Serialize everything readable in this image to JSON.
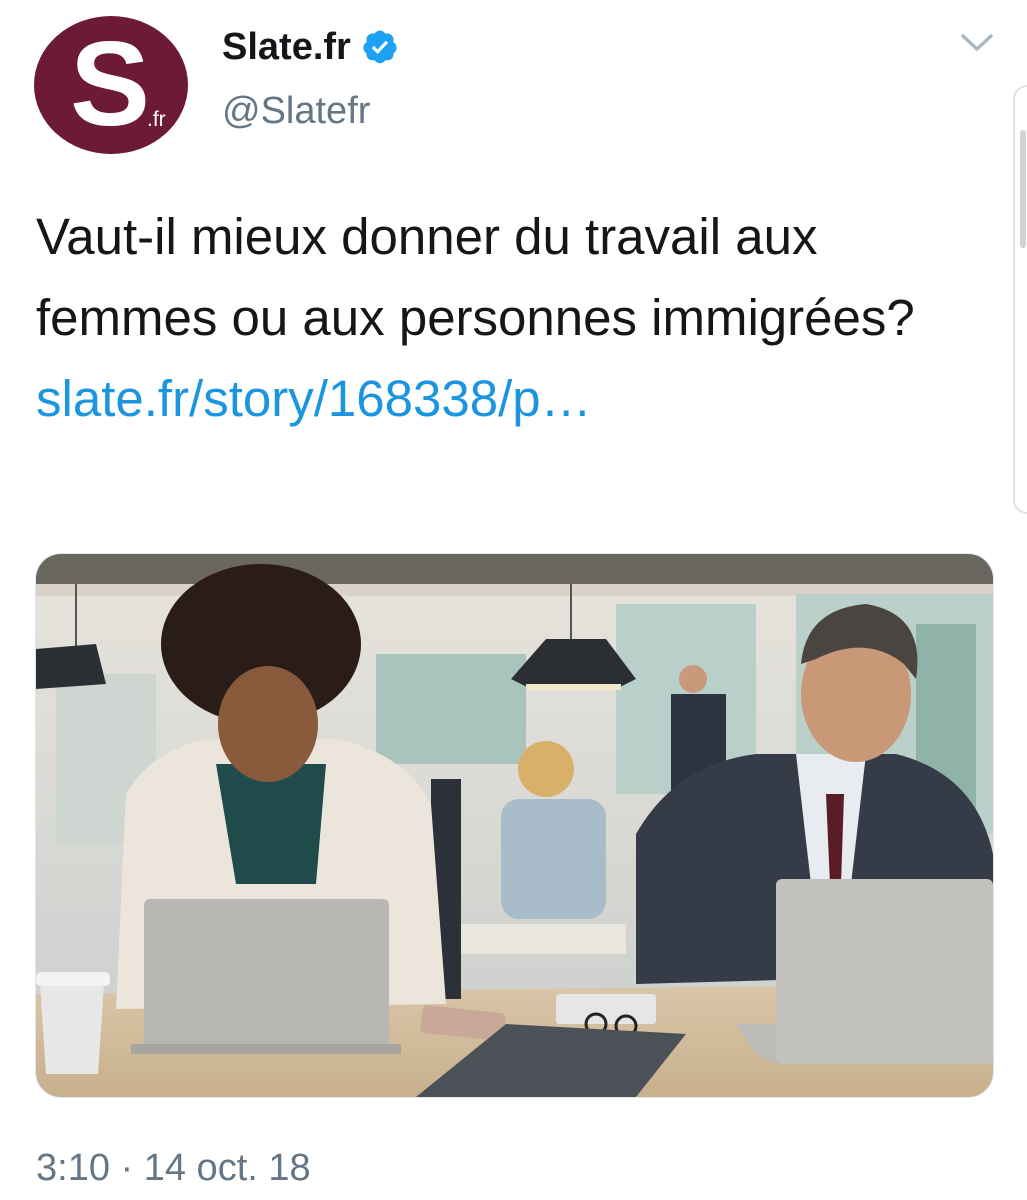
{
  "tweet": {
    "author": {
      "display_name": "Slate.fr",
      "handle": "@Slatefr",
      "avatar": {
        "letter": "S",
        "suffix": ".fr",
        "color": "#6d1a36"
      },
      "verified_icon": "verified-badge-icon"
    },
    "menu_icon": "chevron-down-icon",
    "text": "Vaut-il mieux donner du travail aux femmes ou aux personnes immigrées?",
    "link_text": "slate.fr/story/168338/p…",
    "media": {
      "kind": "photo",
      "description_icon": "office-photo"
    },
    "timestamp": "3:10 · 14 oct. 18"
  },
  "colors": {
    "text": "#14171a",
    "secondary": "#657786",
    "link": "#1b95e0",
    "verified": "#1da1f2",
    "brand": "#6d1a36"
  }
}
